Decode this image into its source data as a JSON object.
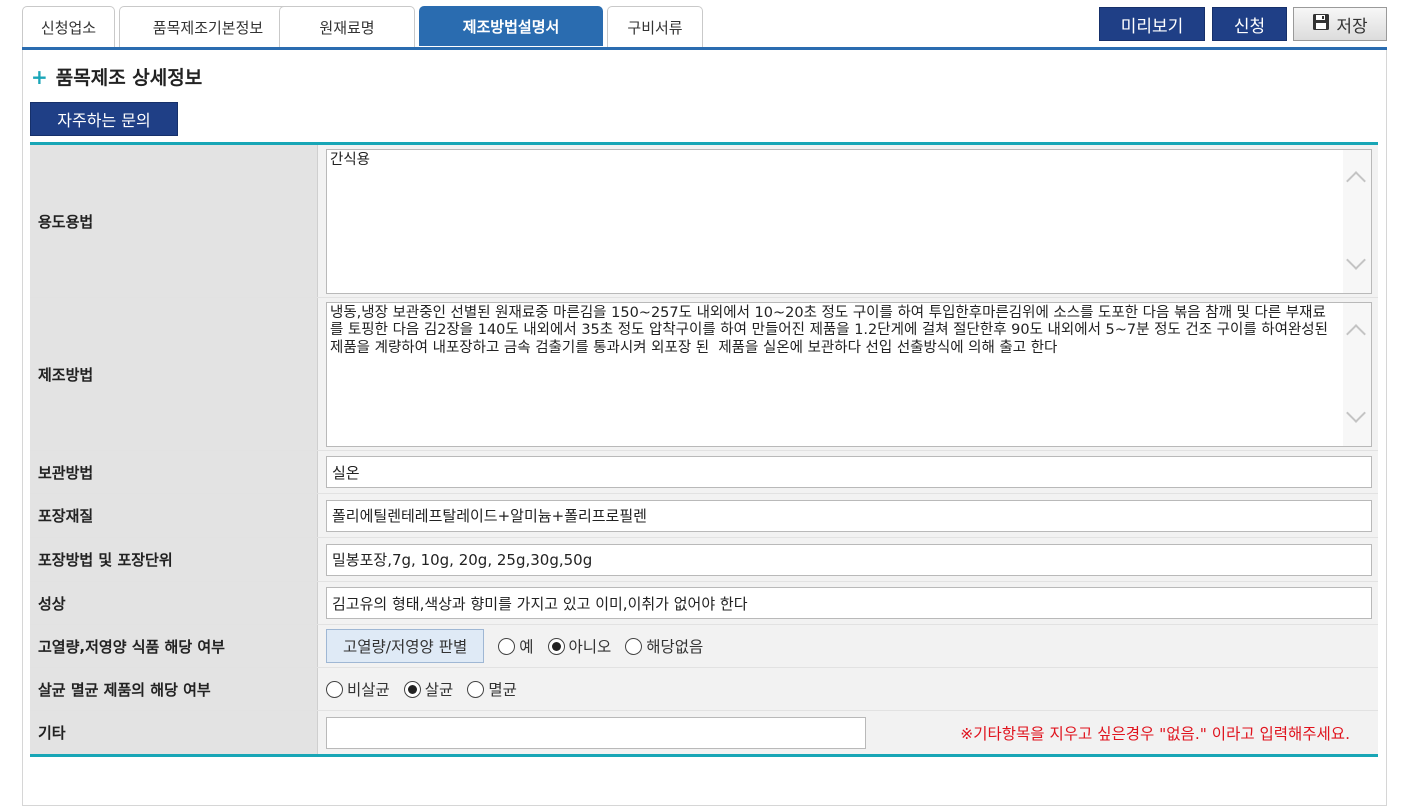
{
  "tabs": [
    {
      "label": "신청업소",
      "active": false
    },
    {
      "label": "품목제조기본정보",
      "active": false
    },
    {
      "label": "원재료명",
      "active": false
    },
    {
      "label": "제조방법설명서",
      "active": true
    },
    {
      "label": "구비서류",
      "active": false
    }
  ],
  "toolbar": {
    "preview_label": "미리보기",
    "apply_label": "신청",
    "save_label": "저장",
    "save_icon": "floppy-disk-icon"
  },
  "section": {
    "title": "품목제조 상세정보",
    "faq_label": "자주하는 문의"
  },
  "fields": {
    "usage": {
      "label": "용도용법",
      "value": "간식용"
    },
    "method": {
      "label": "제조방법",
      "value": "냉동,냉장 보관중인 선별된 원재료중 마른김을 150~257도 내외에서 10~20초 정도 구이를 하여 투입한후마른김위에 소스를 도포한 다음 볶음 참깨 및 다른 부재료를 토핑한 다음 김2장을 140도 내외에서 35초 정도 압착구이를 하여 만들어진 제품을 1.2단게에 걸쳐 절단한후 90도 내외에서 5~7분 정도 건조 구이를 하여완성된 제품을 계량하여 내포장하고 금속 검출기를 통과시켜 외포장 된  제품을 실온에 보관하다 선입 선출방식에 의해 출고 한다"
    },
    "storage": {
      "label": "보관방법",
      "value": "실온"
    },
    "material": {
      "label": "포장재질",
      "value": "폴리에틸렌테레프탈레이드+알미늄+폴리프로필렌"
    },
    "packaging": {
      "label": "포장방법 및 포장단위",
      "value": "밀봉포장,7g, 10g, 20g, 25g,30g,50g"
    },
    "appearance": {
      "label": "성상",
      "value": "김고유의 형태,색상과 향미를 가지고 있고 이미,이취가 없어야 한다"
    },
    "high_calorie": {
      "label": "고열량,저영양 식품 해당 여부",
      "judge_label": "고열량/저영양 판별",
      "options": [
        "예",
        "아니오",
        "해당없음"
      ],
      "selected": "아니오"
    },
    "sterilization": {
      "label": "살균 멸균 제품의 해당 여부",
      "options": [
        "비살균",
        "살균",
        "멸균"
      ],
      "selected": "살균"
    },
    "etc": {
      "label": "기타",
      "value": "",
      "note": "※기타항목을 지우고 싶은경우 \"없음.\" 이라고 입력해주세요."
    }
  },
  "colors": {
    "tab_active": "#2a6cb0",
    "button_dark": "#1f3f86",
    "accent_line": "#18a6b6",
    "note_red": "#e0141e"
  }
}
